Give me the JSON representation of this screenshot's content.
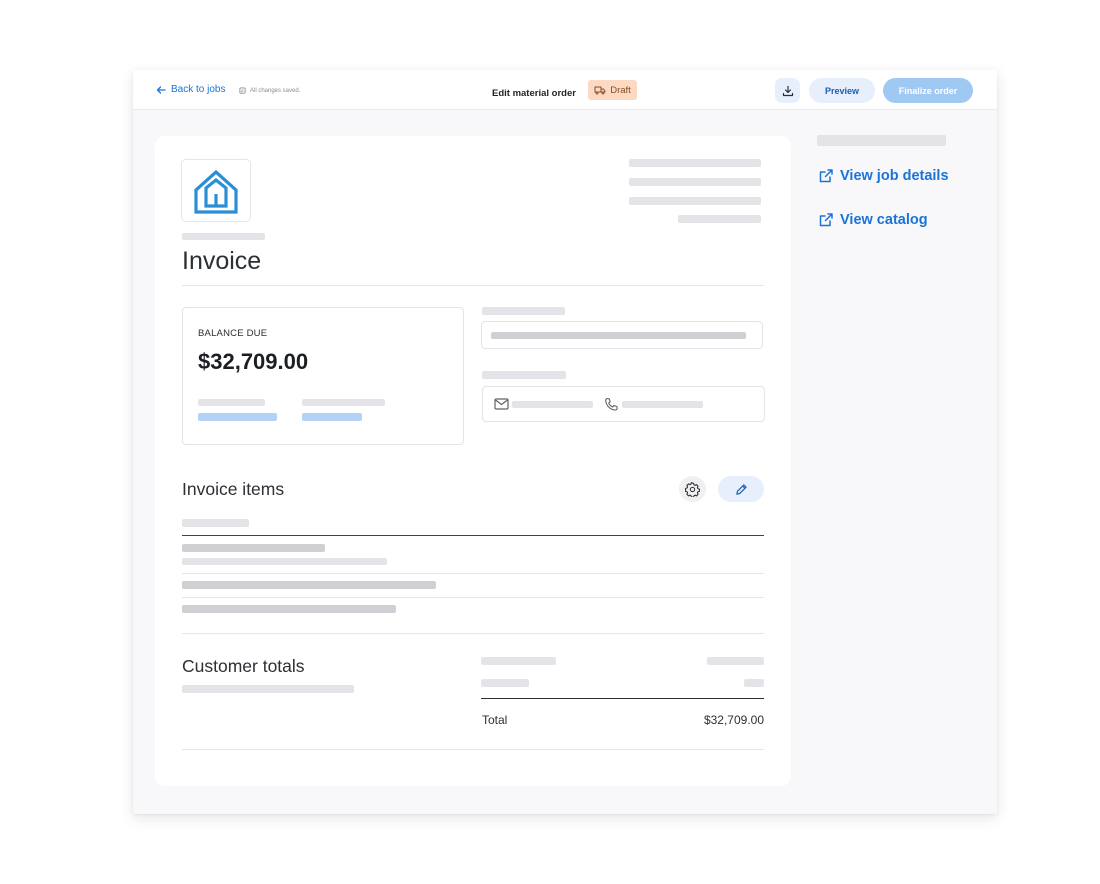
{
  "topbar": {
    "back_label": "Back to jobs",
    "saved_status": "All changes saved.",
    "title": "Edit material order",
    "status_badge": "Draft",
    "preview_label": "Preview",
    "finalize_label": "Finalize order"
  },
  "invoice": {
    "title": "Invoice",
    "balance_label": "BALANCE DUE",
    "balance_amount": "$32,709.00"
  },
  "items": {
    "title": "Invoice items"
  },
  "totals": {
    "title": "Customer totals",
    "total_label": "Total",
    "total_value": "$32,709.00"
  },
  "sidebar": {
    "links": [
      {
        "label": "View job details"
      },
      {
        "label": "View catalog"
      }
    ]
  },
  "colors": {
    "accent": "#1a73d9",
    "draft_badge_bg": "#fbd9c3",
    "finalize_button_bg": "#9fc9f3",
    "logo_blue": "#2a8fd6"
  },
  "icons": {
    "back": "arrow-left-icon",
    "saved": "document-icon",
    "badge": "truck-icon",
    "download": "download-icon",
    "settings": "gear-icon",
    "edit": "pencil-icon",
    "email": "mail-icon",
    "phone": "phone-icon",
    "external": "external-link-icon",
    "logo": "house-logo"
  }
}
